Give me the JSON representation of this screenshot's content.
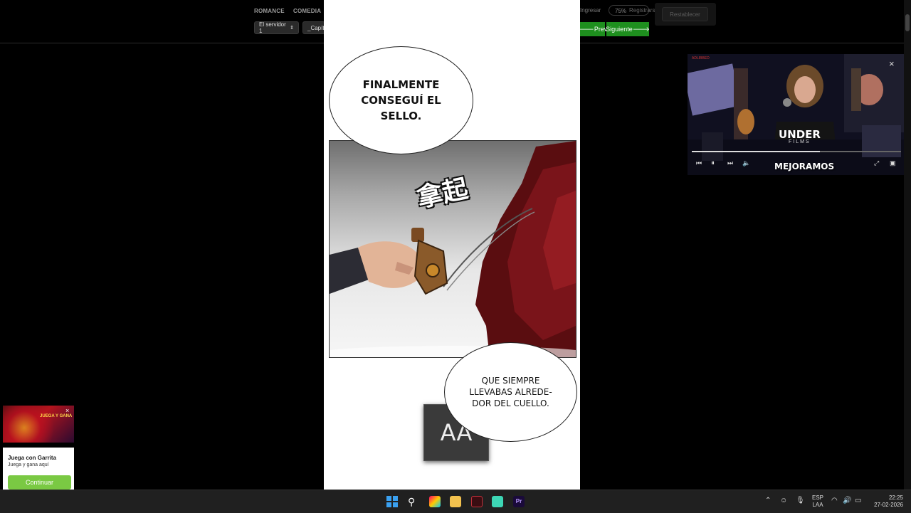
{
  "nav": {
    "links": [
      "ROMANCE",
      "COMEDIA"
    ],
    "server_select": "El servidor 1",
    "chapter_select": "_Capít",
    "login": "Ingresar",
    "register": "Registrarse",
    "zoom": "75%",
    "reset": "Restablecer",
    "prev": "Prev",
    "next": "Siguiente"
  },
  "comic": {
    "bubble_top": [
      "FINALMENTE",
      "CONSEGUÍ EL",
      "SELLO."
    ],
    "sfx": "拿起",
    "bubble_bottom": [
      "QUE SIEMPRE",
      "LLEVABAS ALREDE-",
      "DOR DEL CUELLO."
    ]
  },
  "text_size_overlay": "AA",
  "video": {
    "caption": "MEJORAMOS",
    "shirt_text": "UNDER",
    "shirt_sub": "FILMS",
    "channel_badge": "ADLIBBED"
  },
  "ad": {
    "title": "Juega con Garrita",
    "subtitle": "Juega y gana aquí",
    "button": "Continuar",
    "banner_text": "JUEGA Y GANA"
  },
  "tray": {
    "lang_top": "ESP",
    "lang_bottom": "LAA",
    "time": "22:25",
    "date": "27-02-2026"
  },
  "colors": {
    "accent_green": "#1e8f1e",
    "ad_button": "#7ac943"
  }
}
